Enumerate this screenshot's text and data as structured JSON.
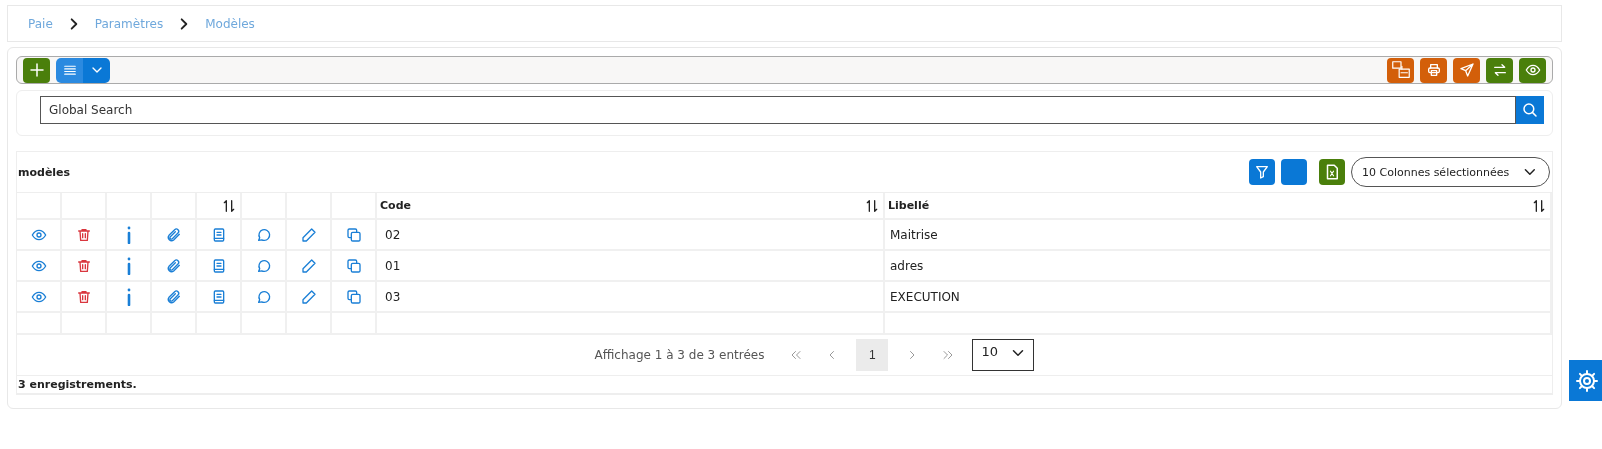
{
  "breadcrumb": [
    "Paie",
    "Paramètres",
    "Modèles"
  ],
  "toolbar": {
    "left": [
      {
        "kind": "add"
      },
      {
        "kind": "menu"
      }
    ],
    "right": [
      {
        "kind": "printers",
        "color": "#d35f0a"
      },
      {
        "kind": "print",
        "color": "#d35f0a"
      },
      {
        "kind": "send",
        "color": "#d35f0a"
      },
      {
        "kind": "swap",
        "color": "#4a7f0b"
      },
      {
        "kind": "view",
        "color": "#4a7f0b"
      }
    ]
  },
  "search": {
    "placeholder": "Global Search"
  },
  "table": {
    "title": "modèles",
    "columns_select": "10 Colonnes sélectionnées",
    "columns": [
      {
        "sortable": false
      },
      {
        "sortable": false
      },
      {
        "sortable": false
      },
      {
        "sortable": false
      },
      {
        "sortable": true
      },
      {
        "sortable": false
      },
      {
        "sortable": false
      },
      {
        "sortable": false
      },
      {
        "label": "Code",
        "sortable": true
      },
      {
        "label": "Libellé",
        "sortable": true
      }
    ],
    "actions": [
      {
        "kind": "view"
      },
      {
        "kind": "delete"
      },
      {
        "kind": "info"
      },
      {
        "kind": "attach"
      },
      {
        "kind": "document"
      },
      {
        "kind": "comment"
      },
      {
        "kind": "edit"
      },
      {
        "kind": "copy"
      }
    ],
    "rows": [
      {
        "code": "02",
        "libelle": "Maitrise"
      },
      {
        "code": "01",
        "libelle": "adres"
      },
      {
        "code": "03",
        "libelle": "EXECUTION"
      }
    ],
    "pagination": {
      "summary": "Affichage 1 à 3 de 3 entrées",
      "pages": [
        {
          "label": "1",
          "selected": true
        }
      ],
      "page_size": "10"
    },
    "footer": "3 enregistrements."
  }
}
